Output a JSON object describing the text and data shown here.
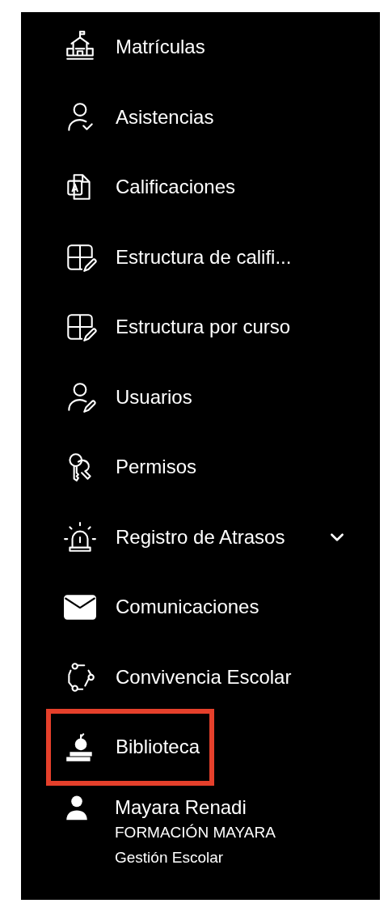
{
  "menu": {
    "items": [
      {
        "label": "Matrículas",
        "highlighted": false
      },
      {
        "label": "Asistencias",
        "highlighted": false
      },
      {
        "label": "Calificaciones",
        "highlighted": false
      },
      {
        "label": "Estructura de califi...",
        "highlighted": false
      },
      {
        "label": "Estructura por curso",
        "highlighted": false
      },
      {
        "label": "Usuarios",
        "highlighted": false
      },
      {
        "label": "Permisos",
        "highlighted": false
      },
      {
        "label": "Registro de Atrasos",
        "highlighted": false,
        "expanded": false
      },
      {
        "label": "Comunicaciones",
        "highlighted": false
      },
      {
        "label": "Convivencia Escolar",
        "highlighted": false
      },
      {
        "label": "Biblioteca",
        "highlighted": true
      }
    ]
  },
  "user": {
    "name": "Mayara Renadi",
    "organization": "FORMACIÓN MAYARA",
    "role": "Gestión Escolar"
  }
}
